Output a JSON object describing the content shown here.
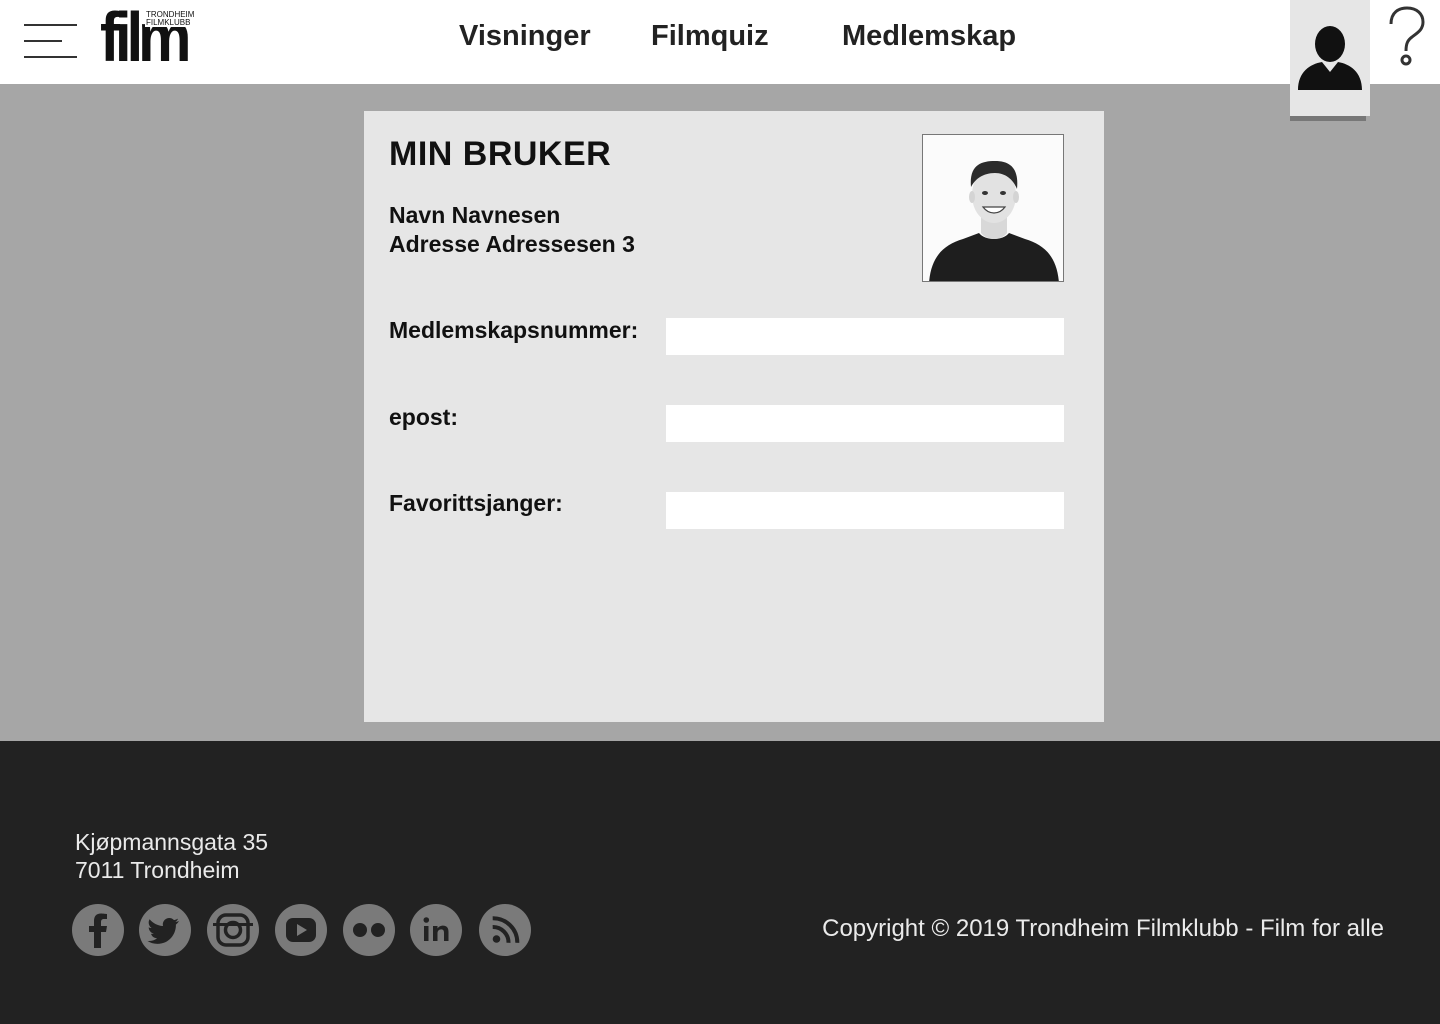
{
  "header": {
    "logo": {
      "word": "film",
      "small_line1": "TRONDHEIM",
      "small_line2": "FILMKLUBB"
    },
    "nav": [
      {
        "label": "Visninger"
      },
      {
        "label": "Filmquiz"
      },
      {
        "label": "Medlemskap"
      }
    ],
    "icons": {
      "menu": "hamburger-icon",
      "profile": "user-icon",
      "help": "question-mark-icon"
    }
  },
  "profile": {
    "title": "MIN BRUKER",
    "name": "Navn Navnesen",
    "address": "Adresse Adressesen 3",
    "photo_icon": "profile-photo",
    "fields": [
      {
        "label": "Medlemskapsnummer:",
        "value": "",
        "placeholder": ""
      },
      {
        "label": "epost:",
        "value": "",
        "placeholder": ""
      },
      {
        "label": "Favorittsjanger:",
        "value": "",
        "placeholder": ""
      }
    ]
  },
  "footer": {
    "address_line1": "Kjøpmannsgata 35",
    "address_line2": "7011 Trondheim",
    "socials": [
      "facebook-icon",
      "twitter-icon",
      "instagram-icon",
      "youtube-icon",
      "flickr-icon",
      "linkedin-icon",
      "rss-icon"
    ],
    "copyright": "Copyright © 2019 Trondheim Filmklubb - Film for alle"
  },
  "colors": {
    "page_bg": "#a6a6a6",
    "header_bg": "#ffffff",
    "card_bg": "#e6e6e6",
    "footer_bg": "#222222",
    "social_icon_bg": "#7a7a7a"
  }
}
